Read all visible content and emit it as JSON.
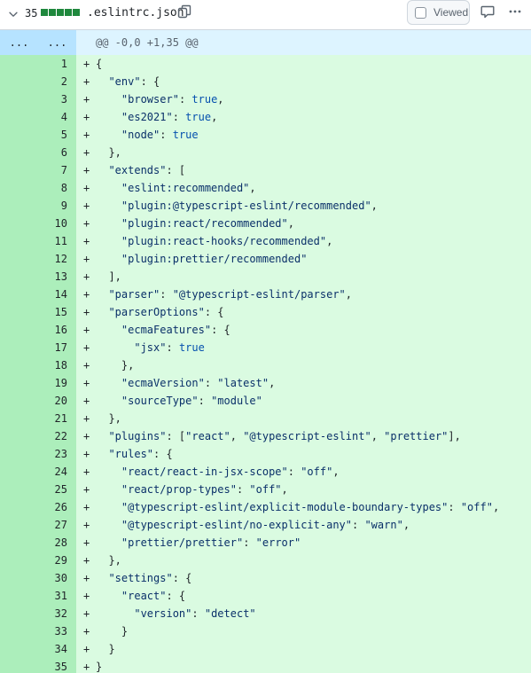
{
  "file": {
    "additions": "35",
    "diffstat_blocks": 5,
    "name": ".eslintrc.json",
    "viewed_label": "Viewed",
    "accent_add": "#1f883d"
  },
  "icons": {
    "collapse": "chevron-down-icon",
    "copy": "copy-icon",
    "comment": "comment-icon",
    "more": "kebab-horizontal-icon"
  },
  "hunk": {
    "expand_old": "...",
    "expand_new": "...",
    "header": "@@ -0,0 +1,35 @@"
  },
  "lines": [
    {
      "n": "1",
      "text": "{"
    },
    {
      "n": "2",
      "text": "  \"env\": {"
    },
    {
      "n": "3",
      "text": "    \"browser\": true,"
    },
    {
      "n": "4",
      "text": "    \"es2021\": true,"
    },
    {
      "n": "5",
      "text": "    \"node\": true"
    },
    {
      "n": "6",
      "text": "  },"
    },
    {
      "n": "7",
      "text": "  \"extends\": ["
    },
    {
      "n": "8",
      "text": "    \"eslint:recommended\","
    },
    {
      "n": "9",
      "text": "    \"plugin:@typescript-eslint/recommended\","
    },
    {
      "n": "10",
      "text": "    \"plugin:react/recommended\","
    },
    {
      "n": "11",
      "text": "    \"plugin:react-hooks/recommended\","
    },
    {
      "n": "12",
      "text": "    \"plugin:prettier/recommended\""
    },
    {
      "n": "13",
      "text": "  ],"
    },
    {
      "n": "14",
      "text": "  \"parser\": \"@typescript-eslint/parser\","
    },
    {
      "n": "15",
      "text": "  \"parserOptions\": {"
    },
    {
      "n": "16",
      "text": "    \"ecmaFeatures\": {"
    },
    {
      "n": "17",
      "text": "      \"jsx\": true"
    },
    {
      "n": "18",
      "text": "    },"
    },
    {
      "n": "19",
      "text": "    \"ecmaVersion\": \"latest\","
    },
    {
      "n": "20",
      "text": "    \"sourceType\": \"module\""
    },
    {
      "n": "21",
      "text": "  },"
    },
    {
      "n": "22",
      "text": "  \"plugins\": [\"react\", \"@typescript-eslint\", \"prettier\"],"
    },
    {
      "n": "23",
      "text": "  \"rules\": {"
    },
    {
      "n": "24",
      "text": "    \"react/react-in-jsx-scope\": \"off\","
    },
    {
      "n": "25",
      "text": "    \"react/prop-types\": \"off\","
    },
    {
      "n": "26",
      "text": "    \"@typescript-eslint/explicit-module-boundary-types\": \"off\","
    },
    {
      "n": "27",
      "text": "    \"@typescript-eslint/no-explicit-any\": \"warn\","
    },
    {
      "n": "28",
      "text": "    \"prettier/prettier\": \"error\""
    },
    {
      "n": "29",
      "text": "  },"
    },
    {
      "n": "30",
      "text": "  \"settings\": {"
    },
    {
      "n": "31",
      "text": "    \"react\": {"
    },
    {
      "n": "32",
      "text": "      \"version\": \"detect\""
    },
    {
      "n": "33",
      "text": "    }"
    },
    {
      "n": "34",
      "text": "  }"
    },
    {
      "n": "35",
      "text": "}"
    }
  ],
  "line_prefix": "+"
}
